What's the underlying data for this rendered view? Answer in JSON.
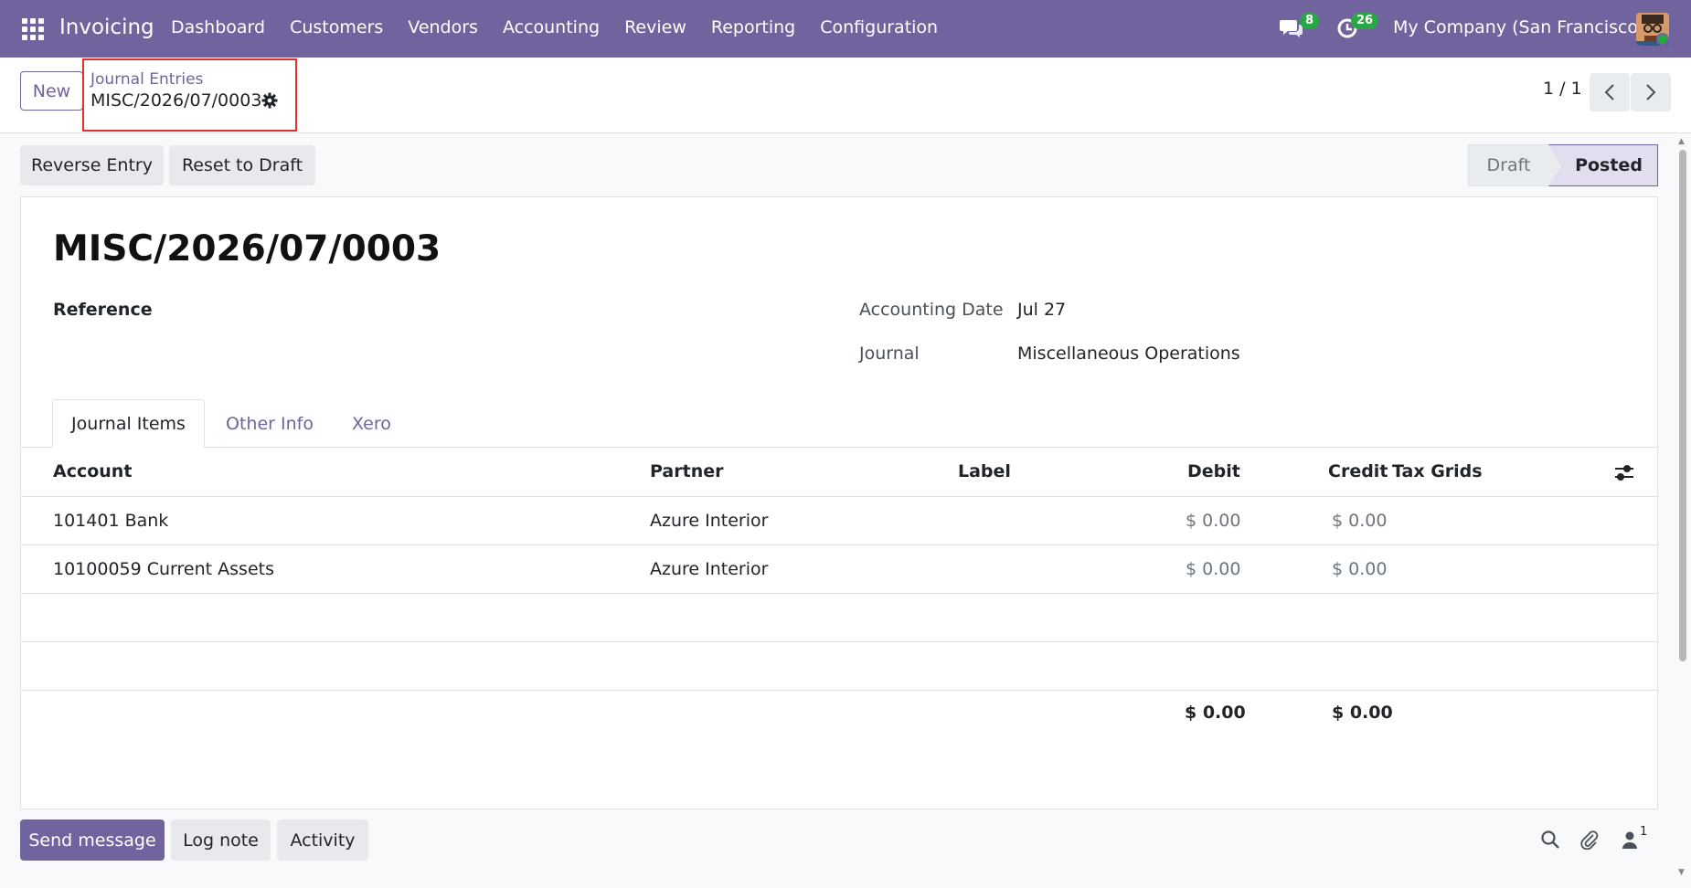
{
  "nav": {
    "app_name": "Invoicing",
    "menu": [
      "Dashboard",
      "Customers",
      "Vendors",
      "Accounting",
      "Review",
      "Reporting",
      "Configuration"
    ],
    "messages_count": "8",
    "activities_count": "26",
    "company": "My Company (San Francisco)"
  },
  "control": {
    "new_label": "New",
    "breadcrumb_parent": "Journal Entries",
    "breadcrumb_current": "MISC/2026/07/0003",
    "pager": "1 / 1"
  },
  "actions": {
    "reverse_label": "Reverse Entry",
    "reset_label": "Reset to Draft",
    "stages": [
      "Draft",
      "Posted"
    ],
    "active_stage": "Posted"
  },
  "form": {
    "title": "MISC/2026/07/0003",
    "reference_label": "Reference",
    "accounting_date_label": "Accounting Date",
    "accounting_date_value": "Jul 27",
    "journal_label": "Journal",
    "journal_value": "Miscellaneous Operations"
  },
  "tabs": [
    "Journal Items",
    "Other Info",
    "Xero"
  ],
  "table": {
    "headers": [
      "Account",
      "Partner",
      "Label",
      "Debit",
      "Credit",
      "Tax Grids"
    ],
    "rows": [
      {
        "account": "101401 Bank",
        "partner": "Azure Interior",
        "label": "",
        "debit": "$ 0.00",
        "credit": "$ 0.00"
      },
      {
        "account": "10100059 Current Assets",
        "partner": "Azure Interior",
        "label": "",
        "debit": "$ 0.00",
        "credit": "$ 0.00"
      }
    ],
    "total_debit": "$ 0.00",
    "total_credit": "$ 0.00"
  },
  "chatter": {
    "send_label": "Send message",
    "log_label": "Log note",
    "activity_label": "Activity",
    "followers_count": "1"
  },
  "colors": {
    "brand": "#71639e",
    "badge": "#28a745",
    "highlight_border": "#e03030"
  }
}
